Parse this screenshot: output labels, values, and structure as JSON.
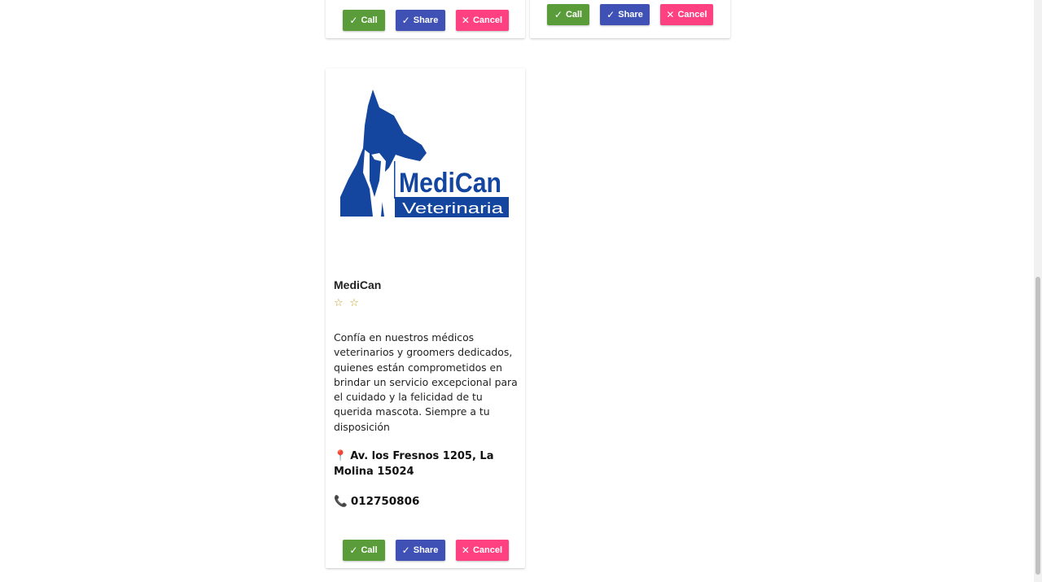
{
  "top_cards": [
    {
      "buttons": {
        "call": "Call",
        "share": "Share",
        "cancel": "Cancel"
      }
    },
    {
      "buttons": {
        "call": "Call",
        "share": "Share",
        "cancel": "Cancel"
      }
    }
  ],
  "main_card": {
    "logo_text": {
      "brand": "MediCan",
      "sub": "Veterinaria"
    },
    "name": "MediCan",
    "stars": "☆ ☆",
    "description": "Confía en nuestros médicos veterinarios y groomers dedicados, quienes están comprometidos en brindar un servicio excepcional para el cuidado y la felicidad de tu querida mascota. Siempre a tu disposición",
    "address": "Av. los Fresnos 1205, La Molina 15024",
    "phone": "012750806",
    "buttons": {
      "call": "Call",
      "share": "Share",
      "cancel": "Cancel"
    }
  },
  "icons": {
    "check": "check-icon",
    "close": "close-icon",
    "pin": "pin-icon",
    "phone": "phone-icon"
  },
  "colors": {
    "call": "#5b9c3a",
    "share": "#3f51b5",
    "cancel": "#ff4081",
    "logo_blue": "#1446a0"
  }
}
